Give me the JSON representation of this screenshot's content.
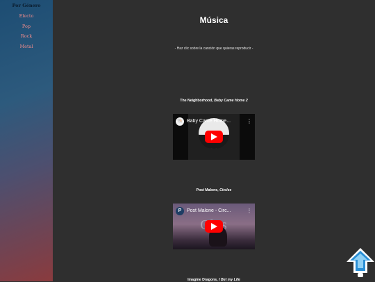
{
  "sidebar": {
    "heading": "Por Género",
    "items": [
      {
        "label": "Electo"
      },
      {
        "label": "Pop"
      },
      {
        "label": "Rock"
      },
      {
        "label": "Metal"
      }
    ]
  },
  "main": {
    "title": "Música",
    "subtitle": "- Haz clic sobre la canción que quieras reproducir -",
    "songs": [
      {
        "artist": "The Neighborhood,",
        "song": "Baby Came Home 2",
        "video_title": "Baby Came Home...",
        "channel_initial": "🐚"
      },
      {
        "artist": "Post Malone,",
        "song": "Circles",
        "video_title": "Post Malone - Circ...",
        "channel_initial": "P",
        "thumb_text": "Cles"
      },
      {
        "artist": "Imagine Dragons,",
        "song": "I Bet my Life"
      }
    ]
  },
  "colors": {
    "sidebar_link": "#f08c8c",
    "youtube_red": "#ff0000",
    "scroll_button": "#3a9ad9"
  },
  "icons": {
    "play": "play-icon",
    "more": "more-vertical-icon",
    "scroll_top": "arrow-up-icon"
  }
}
